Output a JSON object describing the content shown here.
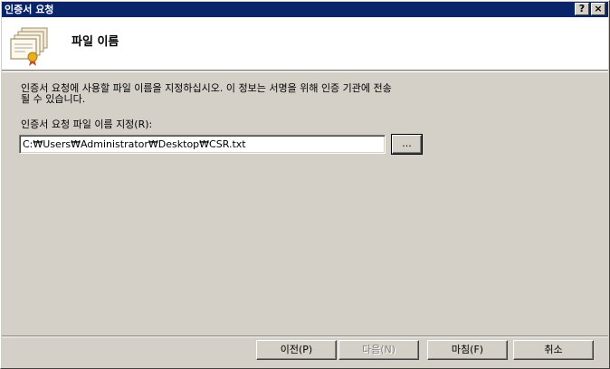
{
  "window": {
    "title": "인증서 요청",
    "help_label": "?",
    "close_label": "×"
  },
  "header": {
    "title": "파일 이름",
    "icon": "certificate-stack-icon"
  },
  "main": {
    "description": "인증서 요청에 사용할 파일 이름을 지정하십시오. 이 정보는 서명을 위해 인증 기관에 전송\n될 수 있습니다.",
    "path_label": "인증서 요청 파일 이름 지정(R):",
    "path_value": "C:₩Users₩Administrator₩Desktop₩CSR.txt",
    "browse_label": "..."
  },
  "footer": {
    "back_label": "이전(P)",
    "next_label": "다음(N)",
    "finish_label": "마침(F)",
    "cancel_label": "취소"
  },
  "colors": {
    "titlebar": "#0a246a",
    "face": "#d4d0c8",
    "header_bg": "#ffffff"
  }
}
